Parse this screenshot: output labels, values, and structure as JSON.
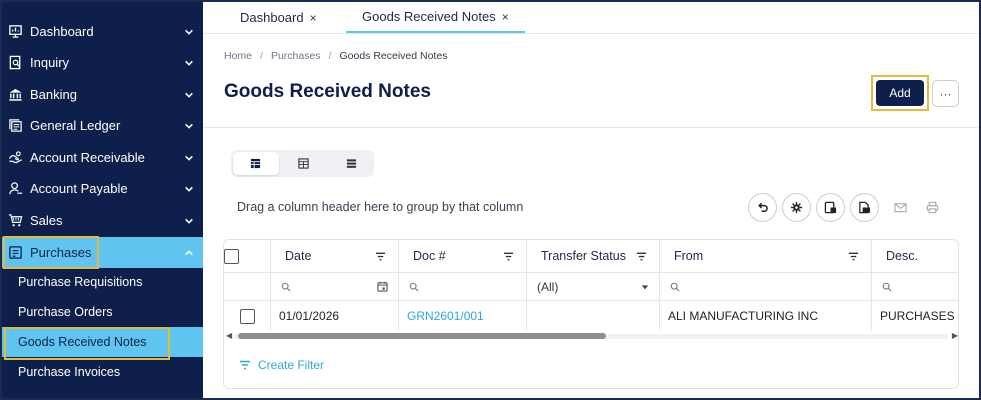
{
  "sidebar": {
    "items": [
      {
        "label": "Dashboard",
        "icon": "dashboard-icon"
      },
      {
        "label": "Inquiry",
        "icon": "inquiry-icon"
      },
      {
        "label": "Banking",
        "icon": "bank-icon"
      },
      {
        "label": "General Ledger",
        "icon": "ledger-icon"
      },
      {
        "label": "Account Receivable",
        "icon": "receivable-icon"
      },
      {
        "label": "Account Payable",
        "icon": "payable-icon"
      },
      {
        "label": "Sales",
        "icon": "sales-icon"
      },
      {
        "label": "Purchases",
        "icon": "purchases-icon"
      }
    ],
    "subitems": [
      {
        "label": "Purchase Requisitions"
      },
      {
        "label": "Purchase Orders"
      },
      {
        "label": "Goods Received Notes"
      },
      {
        "label": "Purchase Invoices"
      }
    ],
    "active_color": "#5fc5f0",
    "bg_color": "#0f1f4b"
  },
  "tabs": [
    {
      "label": "Dashboard",
      "close": "×"
    },
    {
      "label": "Goods Received Notes",
      "close": "×"
    }
  ],
  "breadcrumb": {
    "home": "Home",
    "section": "Purchases",
    "current": "Goods Received Notes",
    "sep": "/"
  },
  "page": {
    "title": "Goods Received Notes",
    "add_label": "Add",
    "more_label": "···"
  },
  "toolbar": {
    "group_hint": "Drag a column header here to group by that column"
  },
  "grid": {
    "columns": [
      "Date",
      "Doc #",
      "Transfer Status",
      "From",
      "Desc."
    ],
    "filters": {
      "transfer_status": "(All)"
    },
    "rows": [
      {
        "date": "01/01/2026",
        "doc": "GRN2601/001",
        "transfer_status": "",
        "from": "ALI MANUFACTURING INC",
        "desc": "PURCHASES"
      }
    ],
    "link_color": "#2ea8d8"
  },
  "footer": {
    "create_filter": "Create Filter"
  }
}
